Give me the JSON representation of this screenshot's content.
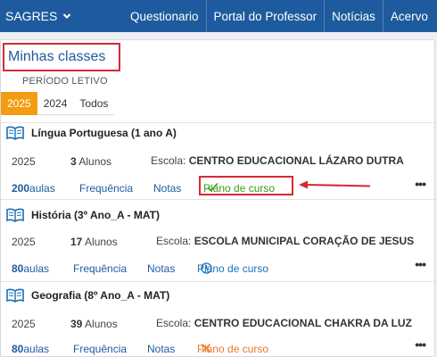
{
  "topbar": {
    "brand": "SAGRES",
    "nav": [
      "Questionario",
      "Portal do Professor",
      "Notícias",
      "Acervo"
    ]
  },
  "page": {
    "title": "Minhas classes",
    "periodo_label": "PERÍODO LETIVO",
    "tabs": [
      "2025",
      "2024",
      "Todos"
    ],
    "active_tab": "2025"
  },
  "classes": [
    {
      "title": "Língua Portuguesa (1 ano A)",
      "year": "2025",
      "students_count": "3",
      "students_label": "Alunos",
      "school_label": "Escola:",
      "school": "CENTRO EDUCACIONAL LÁZARO DUTRA",
      "aulas_count": "200",
      "aulas_label": "aulas",
      "frequencia": "Frequência",
      "notas": "Notas",
      "plano": "Plano de curso",
      "plano_status": "check-icon",
      "plano_color": "#3c9a1f"
    },
    {
      "title": "História (3º Ano_A - MAT)",
      "year": "2025",
      "students_count": "17",
      "students_label": "Alunos",
      "school_label": "Escola:",
      "school": "ESCOLA MUNICIPAL CORAÇÃO DE JESUS",
      "aulas_count": "80",
      "aulas_label": "aulas",
      "frequencia": "Frequência",
      "notas": "Notas",
      "plano": "Plano de curso",
      "plano_status": "clock-icon",
      "plano_color": "#1d6fb8"
    },
    {
      "title": "Geografia (8º Ano_A - MAT)",
      "year": "2025",
      "students_count": "39",
      "students_label": "Alunos",
      "school_label": "Escola:",
      "school": "CENTRO EDUCACIONAL CHAKRA DA LUZ",
      "aulas_count": "80",
      "aulas_label": "aulas",
      "frequencia": "Frequência",
      "notas": "Notas",
      "plano": "Plano de curso",
      "plano_status": "x-icon",
      "plano_color": "#e8782a"
    }
  ],
  "more_label": "•••",
  "colors": {
    "topbar": "#1d5b9e",
    "accent": "#f39c12",
    "highlight": "#d42a35",
    "link": "#1d5b9e"
  }
}
